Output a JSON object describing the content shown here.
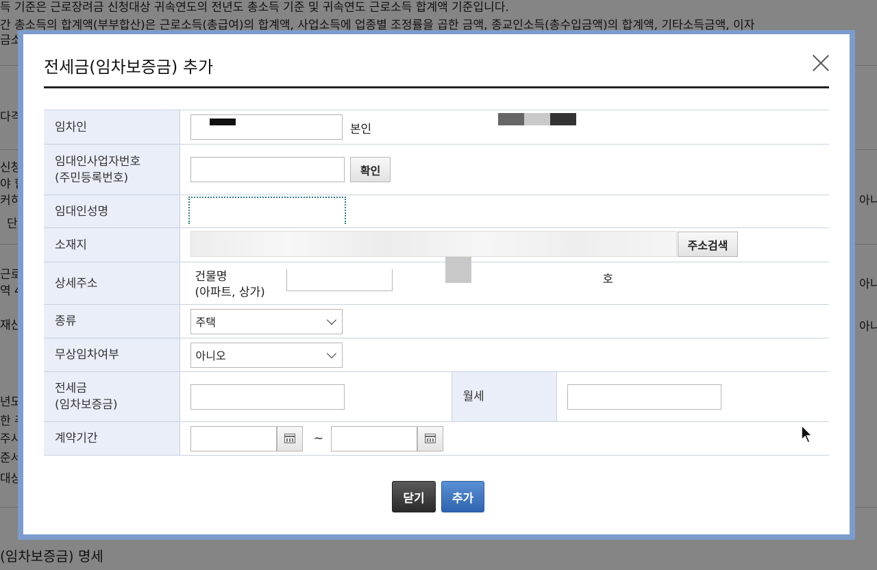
{
  "background": {
    "line1": "득 기준은 근로장려금 신청대상 귀속연도의 전년도 총소득 기준 및 귀속연도 근로소득 합계액 기준입니다.",
    "line2": "간 총소득의 합계액(부부합산)은 근로소득(총급여)의 합계액, 사업소득에 업종별 조정률을 곱한 금액, 종교인소득(총수입금액)의 합계액, 기타소득금액, 이자",
    "line3": "금소",
    "frag_a": "다격",
    "frag_b": "신청",
    "frag_c": "야 합",
    "frag_d": "커히",
    "frag_e": "단",
    "frag_f": "근로",
    "frag_g": "역 4",
    "frag_h": "재산",
    "frag_i": "년도",
    "frag_j": "한 주",
    "frag_k": "주시:",
    "frag_l": "준서",
    "frag_m": "대상",
    "right_1": "아니",
    "right_2": "아니",
    "right_3": "아니",
    "bottom": "(임차보증금) 명세"
  },
  "modal": {
    "title": "전세금(임차보증금) 추가",
    "rows": {
      "lessee": {
        "label": "임차인",
        "suffix": "본인"
      },
      "lessor_id": {
        "label_1": "임대인사업자번호",
        "label_2": "(주민등록번호)",
        "confirm_label": "확인"
      },
      "lessor_name": {
        "label": "임대인성명"
      },
      "location": {
        "label": "소재지",
        "search_label": "주소검색"
      },
      "detail": {
        "label": "상세주소",
        "building_1": "건물명",
        "building_2": "(아파트, 상가)",
        "unit_suffix": "호"
      },
      "type": {
        "label": "종류",
        "selected": "주택"
      },
      "free_lease": {
        "label": "무상임차여부",
        "selected": "아니오"
      },
      "deposit": {
        "label_1": "전세금",
        "label_2": "(임차보증금)",
        "monthly_label": "월세"
      },
      "period": {
        "label": "계약기간",
        "tilde": "~"
      }
    },
    "buttons": {
      "close": "닫기",
      "add": "추가"
    }
  },
  "colors": {
    "frame": "#7b9ccc",
    "label_bg": "#e9eef8",
    "add_button": "#2f65b0",
    "close_button": "#2a2a2a"
  }
}
